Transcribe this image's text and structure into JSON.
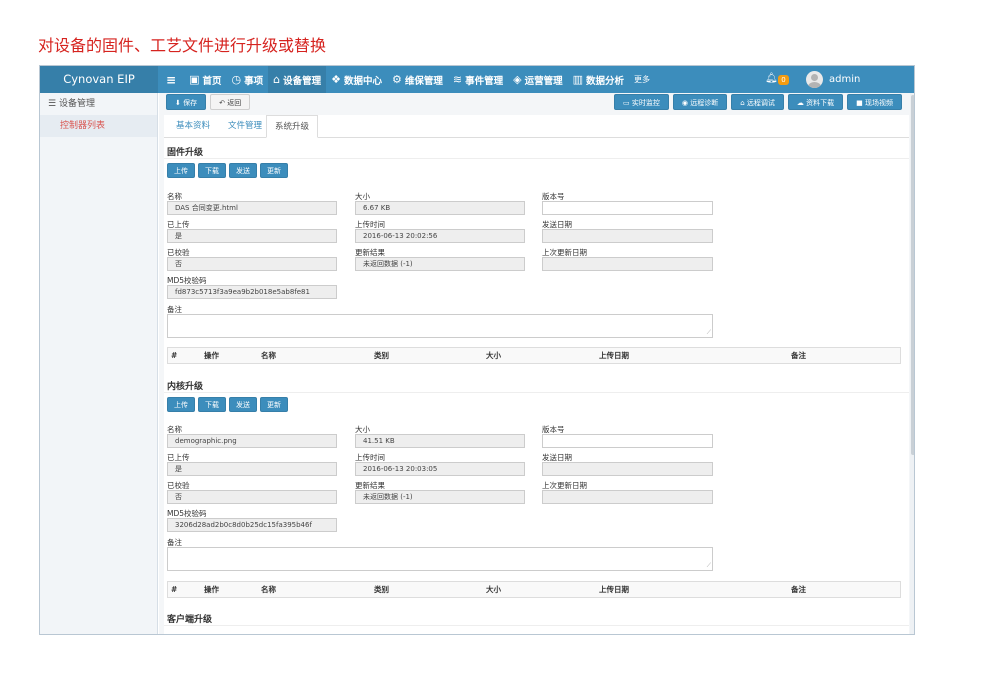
{
  "caption": "对设备的固件、工艺文件进行升级或替换",
  "app": {
    "brand": "Cynovan EIP",
    "nav": [
      {
        "label": "首页",
        "icon": "id-card-icon",
        "glyph": "▣"
      },
      {
        "label": "事项",
        "icon": "clock-icon",
        "glyph": "◷"
      },
      {
        "label": "设备管理",
        "icon": "router-icon",
        "glyph": "⌂"
      },
      {
        "label": "数据中心",
        "icon": "cubes-icon",
        "glyph": "❖"
      },
      {
        "label": "维保管理",
        "icon": "user-gear-icon",
        "glyph": "⚙"
      },
      {
        "label": "事件管理",
        "icon": "layers-icon",
        "glyph": "≋"
      },
      {
        "label": "运营管理",
        "icon": "tags-icon",
        "glyph": "◈"
      },
      {
        "label": "数据分析",
        "icon": "bar-chart-icon",
        "glyph": "▥"
      }
    ],
    "more_label": "更多",
    "notifications": "0",
    "user": "admin"
  },
  "sidebar": {
    "group": "设备管理",
    "items": [
      "控制器列表"
    ]
  },
  "toolbar": {
    "save": "保存",
    "back": "返回",
    "right": [
      "实时监控",
      "远程诊断",
      "远程调试",
      "资料下载",
      "现场视频"
    ]
  },
  "tabs": [
    "基本资料",
    "文件管理",
    "系统升级"
  ],
  "labels": {
    "name": "名称",
    "size": "大小",
    "version": "版本号",
    "uploaded": "已上传",
    "upload_time": "上传时间",
    "send_date": "发送日期",
    "verified": "已校验",
    "update_result": "更新结果",
    "last_update": "上次更新日期",
    "md5": "MD5校验码",
    "remark": "备注"
  },
  "buttons": [
    "上传",
    "下载",
    "发送",
    "更新"
  ],
  "table_headers": [
    "#",
    "操作",
    "名称",
    "类别",
    "大小",
    "上传日期",
    "备注"
  ],
  "sections": [
    {
      "title": "固件升级",
      "name": "DAS 合同变更.html",
      "size": "6.67 KB",
      "version": "",
      "uploaded": "是",
      "upload_time": "2016-06-13 20:02:56",
      "send_date": "",
      "verified": "否",
      "update_result": "未返回数据 (-1)",
      "last_update": "",
      "md5": "fd873c5713f3a9ea9b2b018e5ab8fe81"
    },
    {
      "title": "内核升级",
      "name": "demographic.png",
      "size": "41.51 KB",
      "version": "",
      "uploaded": "是",
      "upload_time": "2016-06-13 20:03:05",
      "send_date": "",
      "verified": "否",
      "update_result": "未返回数据 (-1)",
      "last_update": "",
      "md5": "3206d28ad2b0c8d0b25dc15fa395b46f"
    }
  ],
  "section3_title": "客户端升级"
}
